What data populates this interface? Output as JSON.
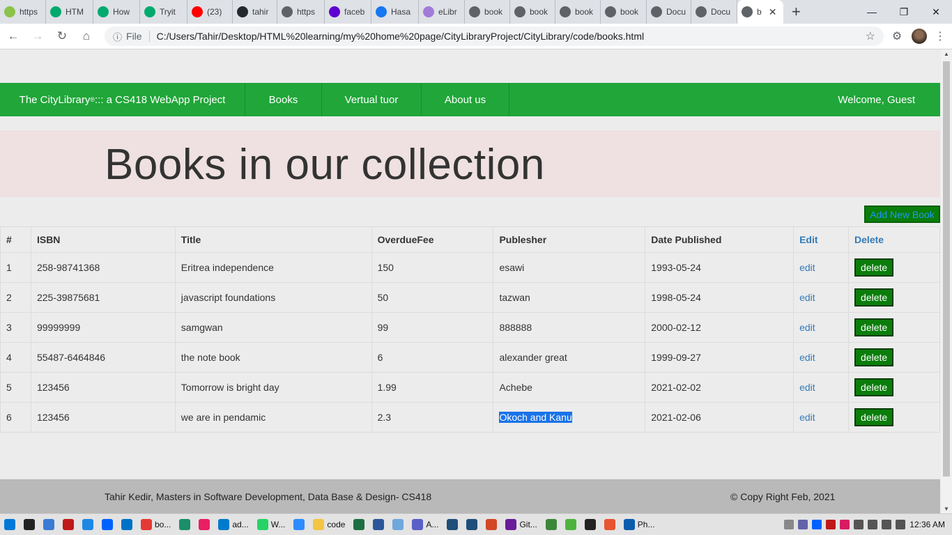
{
  "browser": {
    "tabs": [
      {
        "label": "https",
        "icon": "leaf-icon",
        "color": "#8bc34a"
      },
      {
        "label": "HTM",
        "icon": "w3-icon",
        "color": "#04aa6d"
      },
      {
        "label": "How",
        "icon": "w3-icon",
        "color": "#04aa6d"
      },
      {
        "label": "Tryit",
        "icon": "w3-icon",
        "color": "#04aa6d"
      },
      {
        "label": "(23)",
        "icon": "youtube-icon",
        "color": "#ff0000"
      },
      {
        "label": "tahir",
        "icon": "github-icon",
        "color": "#24292e"
      },
      {
        "label": "https",
        "icon": "globe-icon",
        "color": "#5f6368"
      },
      {
        "label": "faceb",
        "icon": "yahoo-icon",
        "color": "#6001d2"
      },
      {
        "label": "Hasa",
        "icon": "facebook-icon",
        "color": "#1877f2"
      },
      {
        "label": "eLibr",
        "icon": "library-icon",
        "color": "#a27bd8"
      },
      {
        "label": "book",
        "icon": "globe-icon",
        "color": "#5f6368"
      },
      {
        "label": "book",
        "icon": "globe-icon",
        "color": "#5f6368"
      },
      {
        "label": "book",
        "icon": "globe-icon",
        "color": "#5f6368"
      },
      {
        "label": "book",
        "icon": "globe-icon",
        "color": "#5f6368"
      },
      {
        "label": "Docu",
        "icon": "globe-icon",
        "color": "#5f6368"
      },
      {
        "label": "Docu",
        "icon": "globe-icon",
        "color": "#5f6368"
      }
    ],
    "active_tab": {
      "label": "b",
      "icon": "globe-icon"
    },
    "address": {
      "scheme_label": "File",
      "url": "C:/Users/Tahir/Desktop/HTML%20learning/my%20home%20page/CityLibraryProject/CityLibrary/code/books.html"
    }
  },
  "navbar": {
    "brand": "The CityLibrary",
    "brand_mark": "®",
    "brand_suffix": " ::: a CS418 WebApp Project",
    "items": [
      "Books",
      "Vertual tuor",
      "About us"
    ],
    "welcome": "Welcome, Guest",
    "color": "#20a639"
  },
  "heading": "Books in our collection",
  "add_button": "Add New Book",
  "table": {
    "headers": [
      "#",
      "ISBN",
      "Title",
      "OverdueFee",
      "Publesher",
      "Date Published",
      "Edit",
      "Delete"
    ],
    "rows": [
      {
        "num": "1",
        "isbn": "258-98741368",
        "title": "Eritrea independence",
        "fee": "150",
        "publisher": "esawi",
        "date": "1993-05-24",
        "edit": "edit",
        "delete": "delete"
      },
      {
        "num": "2",
        "isbn": "225-39875681",
        "title": "javascript foundations",
        "fee": "50",
        "publisher": "tazwan",
        "date": "1998-05-24",
        "edit": "edit",
        "delete": "delete"
      },
      {
        "num": "3",
        "isbn": "99999999",
        "title": "samgwan",
        "fee": "99",
        "publisher": "888888",
        "date": "2000-02-12",
        "edit": "edit",
        "delete": "delete"
      },
      {
        "num": "4",
        "isbn": "55487-6464846",
        "title": "the note book",
        "fee": "6",
        "publisher": "alexander great",
        "date": "1999-09-27",
        "edit": "edit",
        "delete": "delete"
      },
      {
        "num": "5",
        "isbn": "123456",
        "title": "Tomorrow is bright day",
        "fee": "1.99",
        "publisher": "Achebe",
        "date": "2021-02-02",
        "edit": "edit",
        "delete": "delete"
      },
      {
        "num": "6",
        "isbn": "123456",
        "title": "we are in pendamic",
        "fee": "2.3",
        "publisher": "Okoch and Kanu",
        "date": "2021-02-06",
        "edit": "edit",
        "delete": "delete"
      }
    ]
  },
  "footer": {
    "left": "Tahir Kedir, Masters in Software Development, Data Base & Design- CS418",
    "right": "© Copy Right Feb, 2021"
  },
  "taskbar": {
    "items": [
      {
        "label": "",
        "icon": "windows-start-icon",
        "color": "#0078d7"
      },
      {
        "label": "",
        "icon": "pycharm-icon",
        "color": "#222"
      },
      {
        "label": "",
        "icon": "snipping-icon",
        "color": "#3a7bd5"
      },
      {
        "label": "",
        "icon": "mcafee-icon",
        "color": "#c01818"
      },
      {
        "label": "",
        "icon": "calendar-icon",
        "color": "#1e88e5"
      },
      {
        "label": "",
        "icon": "dropbox-icon",
        "color": "#0061ff"
      },
      {
        "label": "",
        "icon": "outlook-icon",
        "color": "#0072c6"
      },
      {
        "label": "bo...",
        "icon": "chrome-icon",
        "color": "#e53935"
      },
      {
        "label": "",
        "icon": "edge-icon",
        "color": "#1b8f6a"
      },
      {
        "label": "",
        "icon": "paint-icon",
        "color": "#e91e63"
      },
      {
        "label": "ad...",
        "icon": "vscode-icon",
        "color": "#007acc"
      },
      {
        "label": "W...",
        "icon": "whatsapp-icon",
        "color": "#25d366"
      },
      {
        "label": "",
        "icon": "zoom-icon",
        "color": "#2d8cff"
      },
      {
        "label": "code",
        "icon": "folder-icon",
        "color": "#f4c542"
      },
      {
        "label": "",
        "icon": "excel-icon",
        "color": "#1d6f42"
      },
      {
        "label": "",
        "icon": "word-icon",
        "color": "#2b579a"
      },
      {
        "label": "",
        "icon": "notepad-icon",
        "color": "#6fa8dc"
      },
      {
        "label": "A...",
        "icon": "teams-icon",
        "color": "#5b5fc7"
      },
      {
        "label": "",
        "icon": "vs-icon",
        "color": "#1e4e79"
      },
      {
        "label": "",
        "icon": "vs-icon",
        "color": "#1e4e79"
      },
      {
        "label": "",
        "icon": "powerpoint-icon",
        "color": "#d24726"
      },
      {
        "label": "Git...",
        "icon": "eclipse-icon",
        "color": "#6a1b9a"
      },
      {
        "label": "",
        "icon": "node-icon",
        "color": "#3c873a"
      },
      {
        "label": "",
        "icon": "mongodb-icon",
        "color": "#4db33d"
      },
      {
        "label": "",
        "icon": "cmd-icon",
        "color": "#222"
      },
      {
        "label": "",
        "icon": "hotspot-icon",
        "color": "#e8542f"
      },
      {
        "label": "Ph...",
        "icon": "photos-icon",
        "color": "#0a5cad"
      }
    ],
    "clock": "12:36 AM"
  }
}
